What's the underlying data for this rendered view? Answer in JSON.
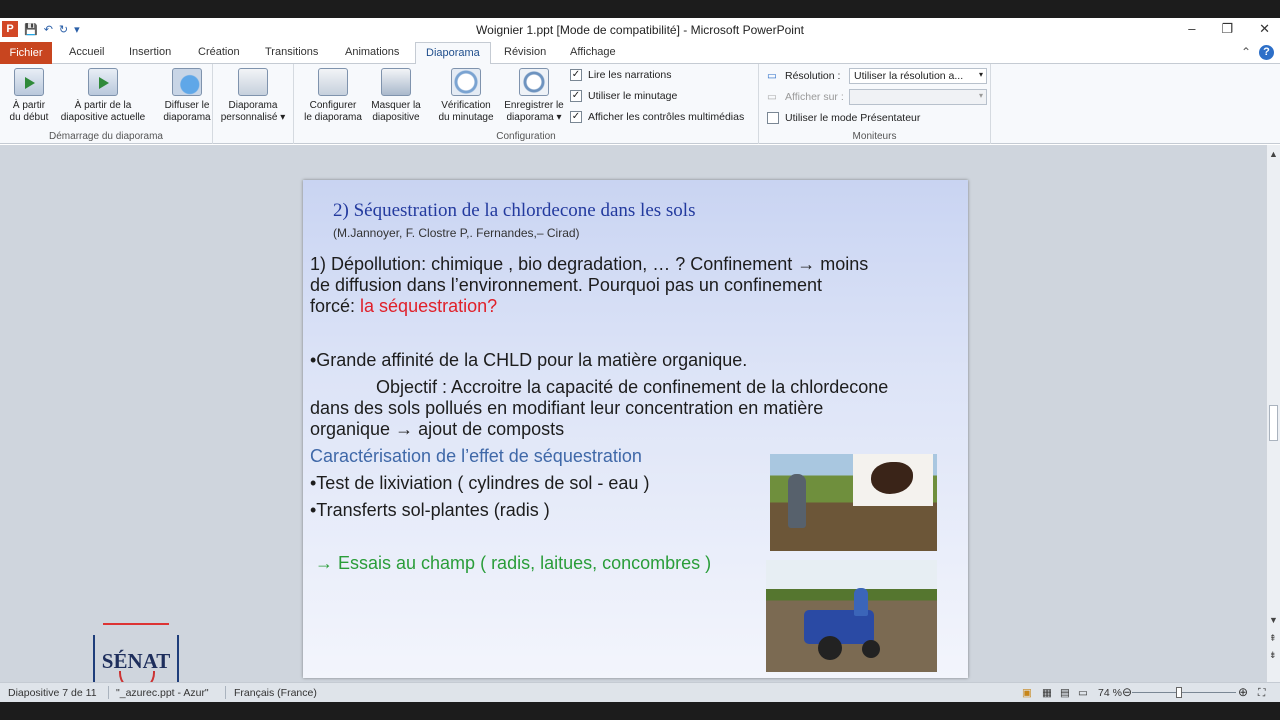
{
  "window": {
    "title": "Woignier 1.ppt [Mode de compatibilité]  -  Microsoft PowerPoint",
    "app_icon": "P",
    "controls": [
      "–",
      "❐",
      "✕"
    ]
  },
  "tabs": [
    "Fichier",
    "Accueil",
    "Insertion",
    "Création",
    "Transitions",
    "Animations",
    "Diaporama",
    "Révision",
    "Affichage"
  ],
  "active_tab": "Diaporama",
  "ribbon": {
    "groups": {
      "start": "Démarrage du diaporama",
      "config": "Configuration",
      "monitors": "Moniteurs"
    },
    "buttons": {
      "from_start": [
        "À partir",
        "du début"
      ],
      "from_current": [
        "À partir de la",
        "diapositive actuelle"
      ],
      "broadcast": [
        "Diffuser le",
        "diaporama"
      ],
      "custom": [
        "Diaporama",
        "personnalisé ▾"
      ],
      "setup": [
        "Configurer",
        "le diaporama"
      ],
      "hide": [
        "Masquer la",
        "diapositive"
      ],
      "rehearse": [
        "Vérification",
        "du minutage"
      ],
      "record": [
        "Enregistrer le",
        "diaporama ▾"
      ]
    },
    "checkboxes": [
      {
        "label": "Lire les narrations",
        "checked": true
      },
      {
        "label": "Utiliser le minutage",
        "checked": true
      },
      {
        "label": "Afficher les contrôles multimédias",
        "checked": true
      }
    ],
    "monitors": {
      "resolution_label": "Résolution :",
      "resolution_value": "Utiliser la résolution a...",
      "show_on_label": "Afficher sur :",
      "presenter_label": "Utiliser le mode Présentateur"
    }
  },
  "slide": {
    "title": "2) Séquestration de la chlordecone dans les sols",
    "authors": "M.Jannoyer, F. Clostre P,. Fernandes,– Cirad)",
    "para1_a": "1) Dépollution:  chimique , bio degradation, … ? Confinement → moins",
    "para1_b": "de diffusion dans l’environnement.     Pourquoi pas un confinement",
    "para1_c": "forcé: ",
    "para1_red": "la séquestration?",
    "bullet1": "•Grande affinité de la CHLD pour la matière organique.",
    "obj_a": "Objectif : Accroitre la capacité de confinement de la chlordecone",
    "obj_b": "dans des sols pollués en  modifiant leur  concentration en matière",
    "obj_c": "organique →  ajout de composts",
    "heading2": "Caractérisation de l’effet de séquestration",
    "bullet2": "•Test de lixiviation ( cylindres de sol - eau )",
    "bullet3": "•Transferts sol-plantes (radis )",
    "green_line": "→ Essais au champ  ( radis, laitues, concombres )"
  },
  "logo": {
    "text": "SÉNAT"
  },
  "status": {
    "slide_num": "Diapositive 7 de 11",
    "theme": "\"_azurec.ppt - Azur\"",
    "lang": "Français (France)",
    "zoom": "74 %"
  },
  "colors": {
    "accent": "#c8451f",
    "title": "#233a9e",
    "red": "#e0202a",
    "green": "#2a9d39"
  }
}
